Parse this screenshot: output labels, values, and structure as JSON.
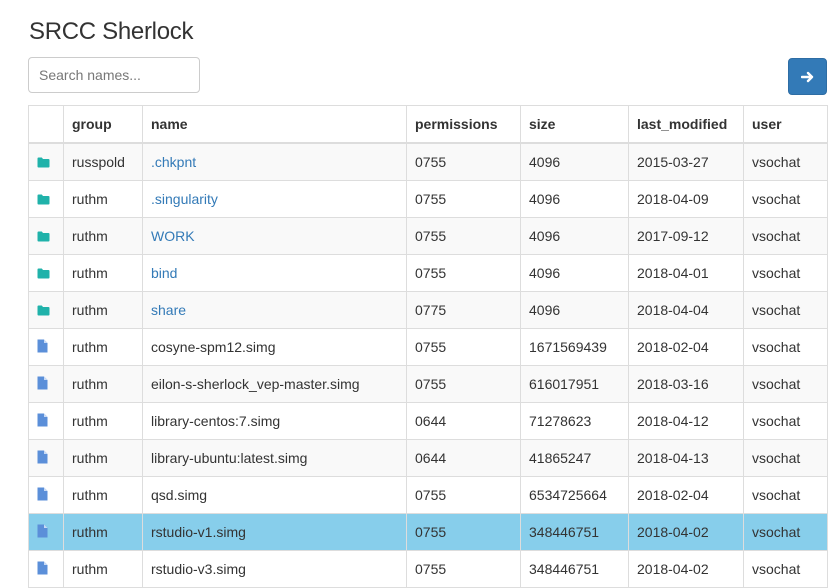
{
  "app": {
    "title": "SRCC Sherlock"
  },
  "search": {
    "placeholder": "Search names...",
    "value": ""
  },
  "go_button": {
    "icon": "arrow-right-icon",
    "color": "#337ab7"
  },
  "table": {
    "columns": [
      "",
      "group",
      "name",
      "permissions",
      "size",
      "last_modified",
      "user"
    ],
    "rows": [
      {
        "type": "folder",
        "icon": "folder-icon",
        "group": "russpold",
        "name": ".chkpnt",
        "permissions": "0755",
        "size": "4096",
        "last_modified": "2015-03-27",
        "user": "vsochat",
        "selected": false
      },
      {
        "type": "folder",
        "icon": "folder-icon",
        "group": "ruthm",
        "name": ".singularity",
        "permissions": "0755",
        "size": "4096",
        "last_modified": "2018-04-09",
        "user": "vsochat",
        "selected": false
      },
      {
        "type": "folder",
        "icon": "folder-icon",
        "group": "ruthm",
        "name": "WORK",
        "permissions": "0755",
        "size": "4096",
        "last_modified": "2017-09-12",
        "user": "vsochat",
        "selected": false
      },
      {
        "type": "folder",
        "icon": "folder-icon",
        "group": "ruthm",
        "name": "bind",
        "permissions": "0755",
        "size": "4096",
        "last_modified": "2018-04-01",
        "user": "vsochat",
        "selected": false
      },
      {
        "type": "folder",
        "icon": "folder-icon",
        "group": "ruthm",
        "name": "share",
        "permissions": "0775",
        "size": "4096",
        "last_modified": "2018-04-04",
        "user": "vsochat",
        "selected": false
      },
      {
        "type": "file",
        "icon": "file-icon",
        "group": "ruthm",
        "name": "cosyne-spm12.simg",
        "permissions": "0755",
        "size": "1671569439",
        "last_modified": "2018-02-04",
        "user": "vsochat",
        "selected": false
      },
      {
        "type": "file",
        "icon": "file-icon",
        "group": "ruthm",
        "name": "eilon-s-sherlock_vep-master.simg",
        "permissions": "0755",
        "size": "616017951",
        "last_modified": "2018-03-16",
        "user": "vsochat",
        "selected": false
      },
      {
        "type": "file",
        "icon": "file-icon",
        "group": "ruthm",
        "name": "library-centos:7.simg",
        "permissions": "0644",
        "size": "71278623",
        "last_modified": "2018-04-12",
        "user": "vsochat",
        "selected": false
      },
      {
        "type": "file",
        "icon": "file-icon",
        "group": "ruthm",
        "name": "library-ubuntu:latest.simg",
        "permissions": "0644",
        "size": "41865247",
        "last_modified": "2018-04-13",
        "user": "vsochat",
        "selected": false
      },
      {
        "type": "file",
        "icon": "file-icon",
        "group": "ruthm",
        "name": "qsd.simg",
        "permissions": "0755",
        "size": "6534725664",
        "last_modified": "2018-02-04",
        "user": "vsochat",
        "selected": false
      },
      {
        "type": "file",
        "icon": "file-icon",
        "group": "ruthm",
        "name": "rstudio-v1.simg",
        "permissions": "0755",
        "size": "348446751",
        "last_modified": "2018-04-02",
        "user": "vsochat",
        "selected": true
      },
      {
        "type": "file",
        "icon": "file-icon",
        "group": "ruthm",
        "name": "rstudio-v3.simg",
        "permissions": "0755",
        "size": "348446751",
        "last_modified": "2018-04-02",
        "user": "vsochat",
        "selected": false
      }
    ]
  },
  "colors": {
    "folder_icon": "#20b2aa",
    "file_icon": "#5b8fd9",
    "link": "#337ab7",
    "selected_row": "#87ceeb",
    "stripe": "#f9f9f9"
  }
}
